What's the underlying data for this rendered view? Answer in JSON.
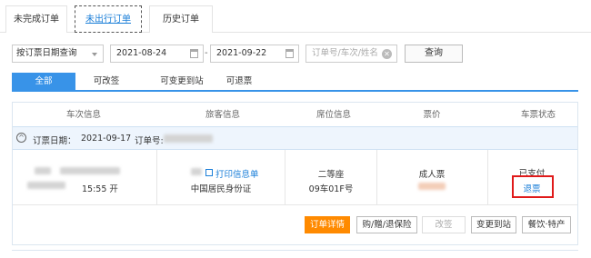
{
  "top_tabs": [
    {
      "label": "未完成订单"
    },
    {
      "label": "未出行订单"
    },
    {
      "label": "历史订单"
    }
  ],
  "filters": {
    "query_type": "按订票日期查询",
    "start_date": "2021-08-24",
    "separator": "-",
    "end_date": "2021-09-22",
    "search_placeholder": "订单号/车次/姓名",
    "query_button": "查询"
  },
  "sub_tabs": [
    {
      "label": "全部"
    },
    {
      "label": "可改签"
    },
    {
      "label": "可变更到站"
    },
    {
      "label": "可退票"
    }
  ],
  "table": {
    "headers": [
      "车次信息",
      "旅客信息",
      "席位信息",
      "票价",
      "车票状态"
    ]
  },
  "order": {
    "booking_date_label": "订票日期：",
    "booking_date": "2021-09-17",
    "order_no_label": "订单号:",
    "departure_time": "15:55 开",
    "print_link": "打印信息单",
    "id_type": "中国居民身份证",
    "seat_class": "二等座",
    "seat_no": "09车01F号",
    "ticket_type": "成人票",
    "status": "已支付",
    "refund_link": "退票"
  },
  "actions": {
    "order_detail": "订单详情",
    "buy_insurance": "购/赠/退保险",
    "change": "改签",
    "change_station": "变更到站",
    "food": "餐饮·特产"
  },
  "colors": {
    "accent": "#3893e8",
    "link": "#1a7ed8",
    "primary_button": "#ff8a00",
    "highlight_box": "#e01a1a"
  }
}
